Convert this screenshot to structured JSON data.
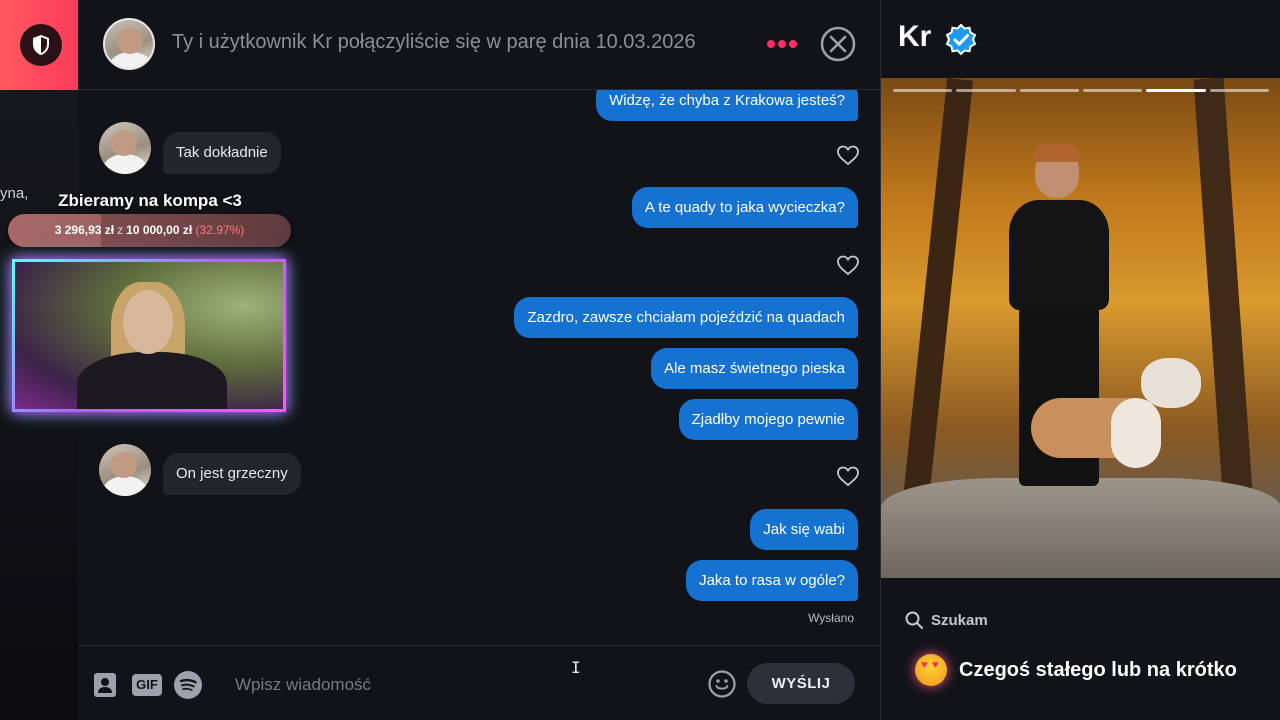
{
  "sidebar": {
    "cut_text": "yna,"
  },
  "chat": {
    "header_title": "Ty i użytkownik Kr połączyliście się w parę dnia 10.03.2026",
    "messages": [
      {
        "dir": "out",
        "text": "Widzę, że chyba z Krakowa jesteś?"
      },
      {
        "dir": "in",
        "text": "Tak dokładnie"
      },
      {
        "dir": "out",
        "text": "A te quady to jaka wycieczka?"
      },
      {
        "dir": "out",
        "text": "Zazdro, zawsze chciałam pojeździć na quadach"
      },
      {
        "dir": "out",
        "text": "Ale masz świetnego pieska"
      },
      {
        "dir": "out",
        "text": "Zjadłby mojego pewnie"
      },
      {
        "dir": "in",
        "text": "On jest grzeczny"
      },
      {
        "dir": "out",
        "text": "Jak się wabi"
      },
      {
        "dir": "out",
        "text": "Jaka to rasa w ogóle?"
      }
    ],
    "sent_status": "Wysłano"
  },
  "composer": {
    "gif_label": "GIF",
    "placeholder": "Wpisz wiadomość",
    "send_label": "WYŚLIJ"
  },
  "overlay": {
    "donation_title": "Zbieramy na kompa <3",
    "donation_current": "3 296,93 zł",
    "donation_separator": "z",
    "donation_goal": "10 000,00 zł",
    "donation_percent": "(32.97%)",
    "donation_progress": 0.3297
  },
  "profile": {
    "name": "Kr",
    "photo_count": 6,
    "photo_active_index": 4,
    "looking_label": "Szukam",
    "relationship_text": "Czegoś stałego lub na krótko"
  },
  "colors": {
    "brand_gradient_start": "#ff5a5f",
    "accent_pink": "#fd2f6a",
    "bubble_out": "#1572d0",
    "bubble_in": "#23252c",
    "verified_blue": "#1d9bf0"
  }
}
